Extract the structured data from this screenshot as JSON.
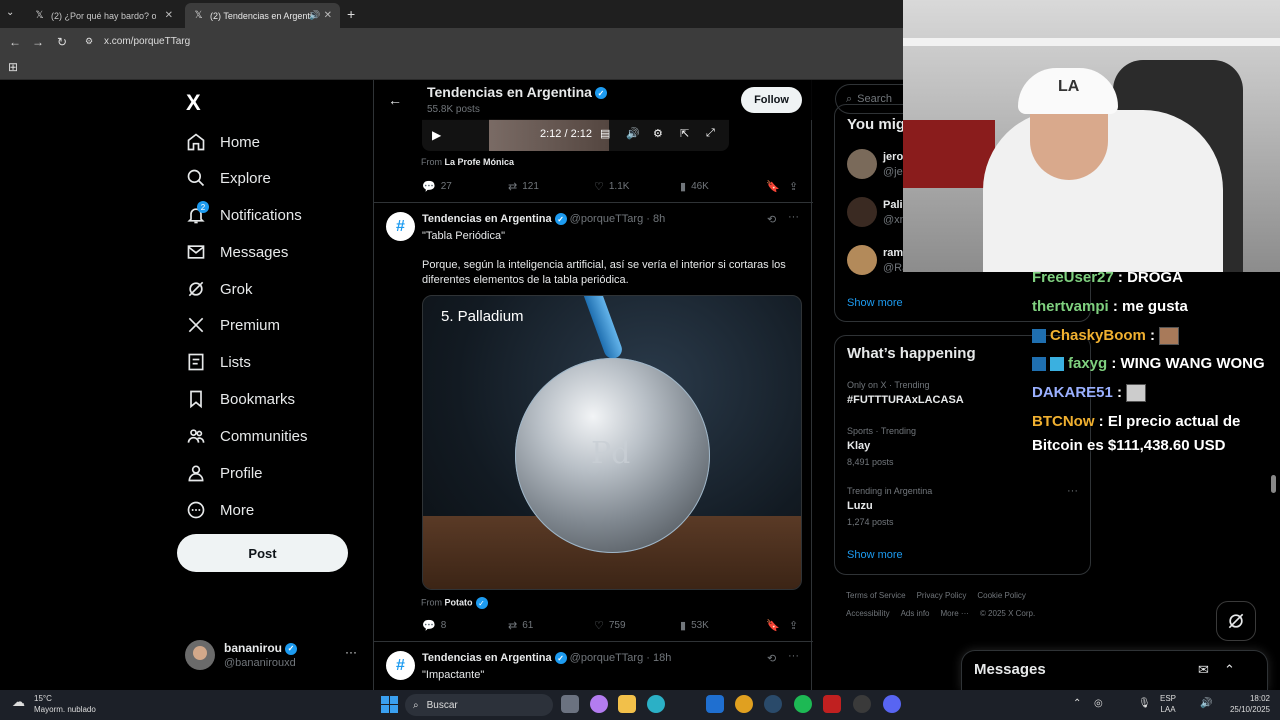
{
  "browser": {
    "tabs": [
      {
        "label": "(2) ¿Por qué hay bardo? on X: \"..."
      },
      {
        "label": "(2) Tendencias en Argentina"
      }
    ],
    "url": "x.com/porqueTTarg"
  },
  "sidebar": {
    "logo": "X",
    "items": [
      {
        "label": "Home",
        "icon": "home-icon"
      },
      {
        "label": "Explore",
        "icon": "search-icon"
      },
      {
        "label": "Notifications",
        "icon": "bell-icon",
        "badge": "2"
      },
      {
        "label": "Messages",
        "icon": "envelope-icon"
      },
      {
        "label": "Grok",
        "icon": "grok-icon"
      },
      {
        "label": "Premium",
        "icon": "x-icon"
      },
      {
        "label": "Lists",
        "icon": "list-icon"
      },
      {
        "label": "Bookmarks",
        "icon": "bookmark-icon"
      },
      {
        "label": "Communities",
        "icon": "communities-icon"
      },
      {
        "label": "Profile",
        "icon": "person-icon"
      },
      {
        "label": "More",
        "icon": "more-circle-icon"
      }
    ],
    "post_label": "Post",
    "account": {
      "name": "bananirou",
      "handle": "@bananirouxd",
      "more": "···"
    }
  },
  "header": {
    "title": "Tendencias en Argentina",
    "subtitle": "55.8K posts",
    "follow_label": "Follow"
  },
  "video": {
    "time": "2:12 / 2:12"
  },
  "tweets": [
    {
      "from_prefix": "From",
      "from_name": "La Profe Mónica",
      "replies": "27",
      "reposts": "121",
      "likes": "1.1K",
      "views": "46K"
    },
    {
      "avatar": "#",
      "name": "Tendencias en Argentina",
      "handle": "@porqueTTarg",
      "time": "· 8h",
      "title_text": "\"Tabla Periódica\"",
      "body": "Porque, según la inteligencia artificial, así se vería el interior si cortaras los diferentes elementos de la tabla periódica.",
      "media_label": "5. Palladium",
      "media_symbol": "Pd",
      "from_prefix": "From",
      "from_name": "Potato",
      "replies": "8",
      "reposts": "61",
      "likes": "759",
      "views": "53K"
    },
    {
      "avatar": "#",
      "name": "Tendencias en Argentina",
      "handle": "@porqueTTarg",
      "time": "· 18h",
      "title_text": "\"Impactante\""
    }
  ],
  "right": {
    "search_placeholder": "Search",
    "who_title": "You mig",
    "who": [
      {
        "name": "jero",
        "handle": "@jer"
      },
      {
        "name": "Pali",
        "handle": "@xn"
      },
      {
        "name": "ram",
        "handle": "@Ra"
      }
    ],
    "show_more": "Show more",
    "happening_title": "What’s happening",
    "trends": [
      {
        "meta": "Only on X · Trending",
        "name": "#FUTTTURAxLACASA",
        "posts": ""
      },
      {
        "meta": "Sports · Trending",
        "name": "Klay",
        "posts": "8,491 posts"
      },
      {
        "meta": "Trending in Argentina",
        "name": "Luzu",
        "posts": "1,274 posts"
      }
    ],
    "show_more_2": "Show more",
    "footer_line1": [
      "Terms of Service",
      "Privacy Policy",
      "Cookie Policy"
    ],
    "footer_line2": [
      "Accessibility",
      "Ads info",
      "More ···",
      "© 2025 X Corp."
    ]
  },
  "messages_drawer": {
    "title": "Messages"
  },
  "chat": [
    {
      "user": "FreeUser27",
      "msg": " : DROGA"
    },
    {
      "user": "thertvampi",
      "msg": " : me gusta"
    },
    {
      "user": "ChaskyBoom",
      "msg": " : "
    },
    {
      "user": "faxyg",
      "msg": " : WING WANG WONG"
    },
    {
      "user": "DAKARE51",
      "msg": " : "
    },
    {
      "user": "BTCNow",
      "msg": " : El precio actual de"
    },
    {
      "user": "",
      "msg": "Bitcoin es $111,438.60 USD"
    }
  ],
  "webcam": {
    "cap_logo": "LA"
  },
  "taskbar": {
    "temp": "15°C",
    "weather": "Mayorm. nublado",
    "search": "Buscar",
    "lang1": "ESP",
    "lang2": "LAA",
    "time": "18:02",
    "date": "25/10/2025"
  }
}
